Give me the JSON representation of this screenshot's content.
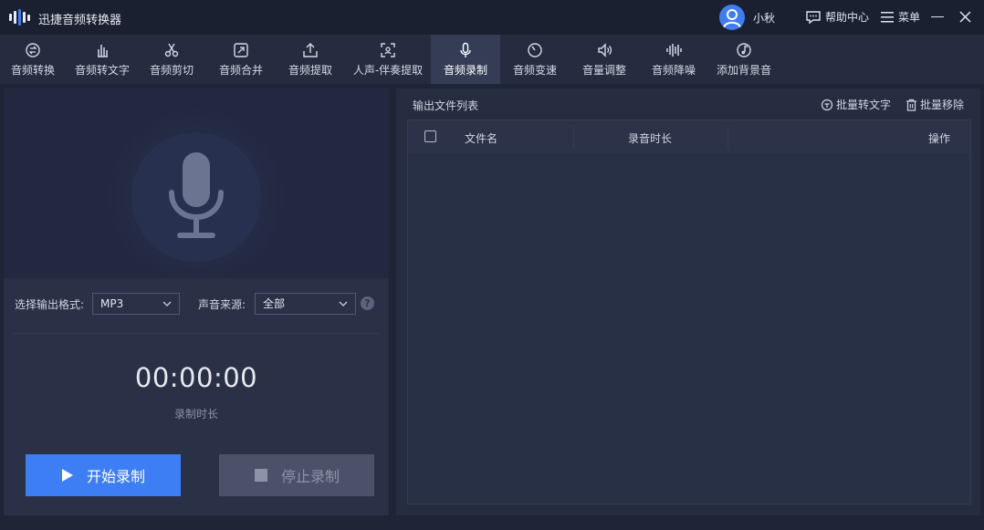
{
  "app": {
    "title": "迅捷音频转换器"
  },
  "user": {
    "name": "小秋"
  },
  "header": {
    "help_label": "帮助中心",
    "menu_label": "菜单"
  },
  "toolbar": {
    "items": [
      {
        "label": "音频转换",
        "icon": "convert-icon"
      },
      {
        "label": "音频转文字",
        "icon": "hand-text-icon"
      },
      {
        "label": "音频剪切",
        "icon": "scissors-icon"
      },
      {
        "label": "音频合并",
        "icon": "merge-icon"
      },
      {
        "label": "音频提取",
        "icon": "upload-icon"
      },
      {
        "label": "人声-伴奏提取",
        "icon": "voice-scan-icon"
      },
      {
        "label": "音频录制",
        "icon": "mic-icon"
      },
      {
        "label": "音频变速",
        "icon": "speedometer-icon"
      },
      {
        "label": "音量调整",
        "icon": "volume-icon"
      },
      {
        "label": "音频降噪",
        "icon": "waveform-icon"
      },
      {
        "label": "添加背景音",
        "icon": "music-note-icon"
      }
    ],
    "active_index": 6
  },
  "recorder": {
    "format_label": "选择输出格式:",
    "format_value": "MP3",
    "source_label": "声音来源:",
    "source_value": "全部",
    "timer": "00:00:00",
    "timer_label": "录制时长",
    "start_label": "开始录制",
    "stop_label": "停止录制"
  },
  "output": {
    "title": "输出文件列表",
    "batch_text_label": "批量转文字",
    "batch_remove_label": "批量移除",
    "columns": {
      "name": "文件名",
      "duration": "录音时长",
      "action": "操作"
    },
    "rows": []
  },
  "colors": {
    "accent": "#3d7ef5",
    "background": "#1f2436",
    "panel": "#2a3045"
  }
}
